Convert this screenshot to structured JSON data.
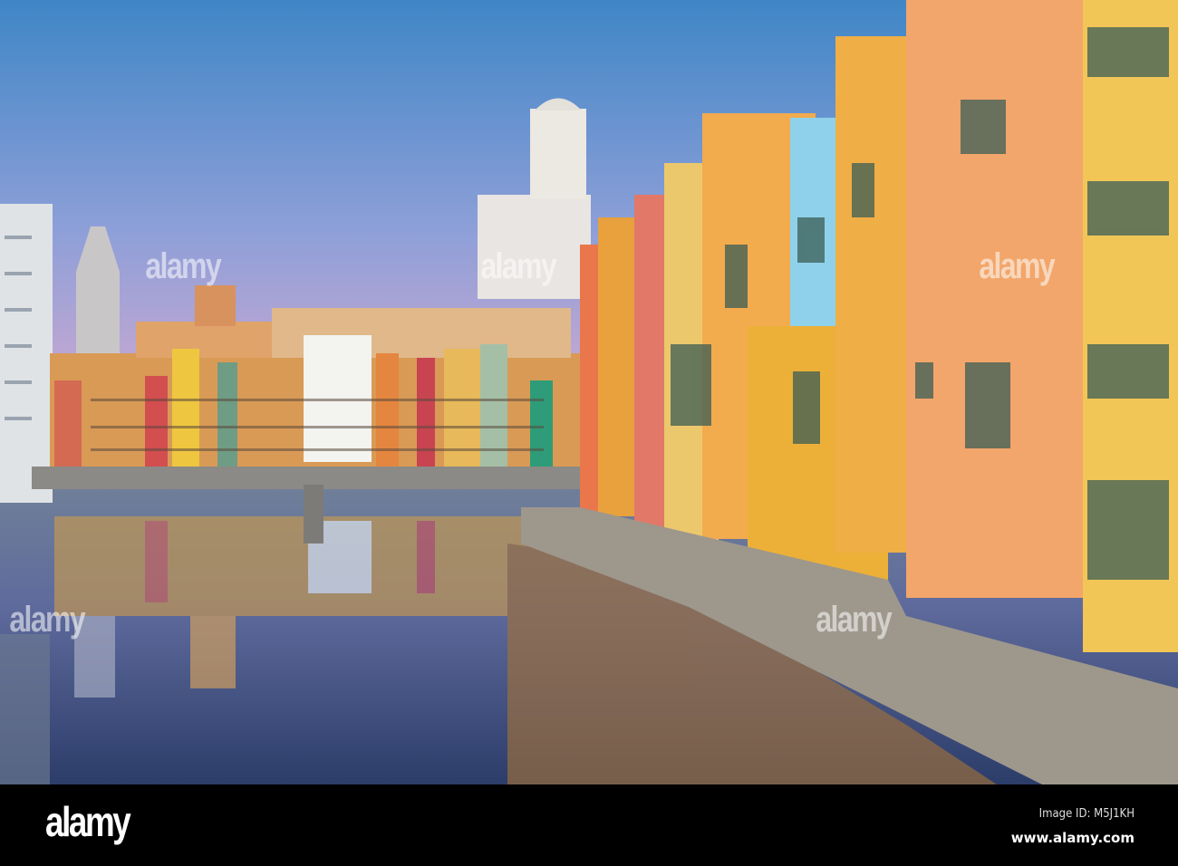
{
  "photo": {
    "subject": "Colorful riverside houses with cathedral reflected in river"
  },
  "watermark": {
    "text": "alamy"
  },
  "footer": {
    "logo": "alamy",
    "image_id": "Image ID: M5J1KH",
    "url": "www.alamy.com"
  }
}
